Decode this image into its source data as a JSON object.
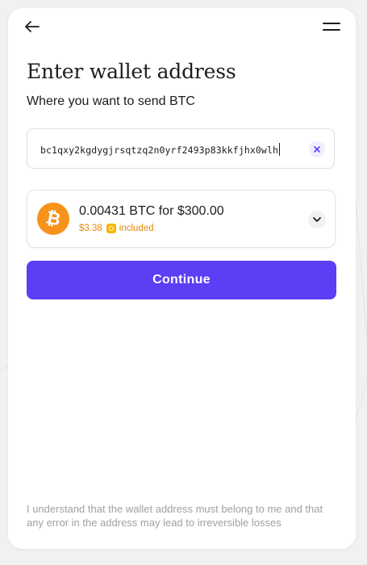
{
  "header": {
    "back_icon": "arrow-left-icon",
    "menu_icon": "hamburger-menu-icon"
  },
  "page": {
    "title": "Enter wallet address",
    "subtitle": "Where you want to send BTC"
  },
  "address_field": {
    "value": "bc1qxy2kgdygjrsqtzq2n0yrf2493p83kkfjhx0wlh",
    "clear_icon": "close-x-icon"
  },
  "quote": {
    "asset_icon": "bitcoin-icon",
    "summary": "0.00431 BTC for $300.00",
    "fee_amount": "$3.38",
    "fee_suffix": "included",
    "fee_icon": "fee-coin-icon",
    "expand_icon": "chevron-down-icon"
  },
  "actions": {
    "continue_label": "Continue"
  },
  "footer": {
    "disclaimer": "I understand that the wallet address must belong to me and that any error in the address may lead to irreversible losses"
  },
  "colors": {
    "accent": "#5a3ff5",
    "bitcoin": "#f7931a",
    "fee_text": "#e0890e"
  }
}
